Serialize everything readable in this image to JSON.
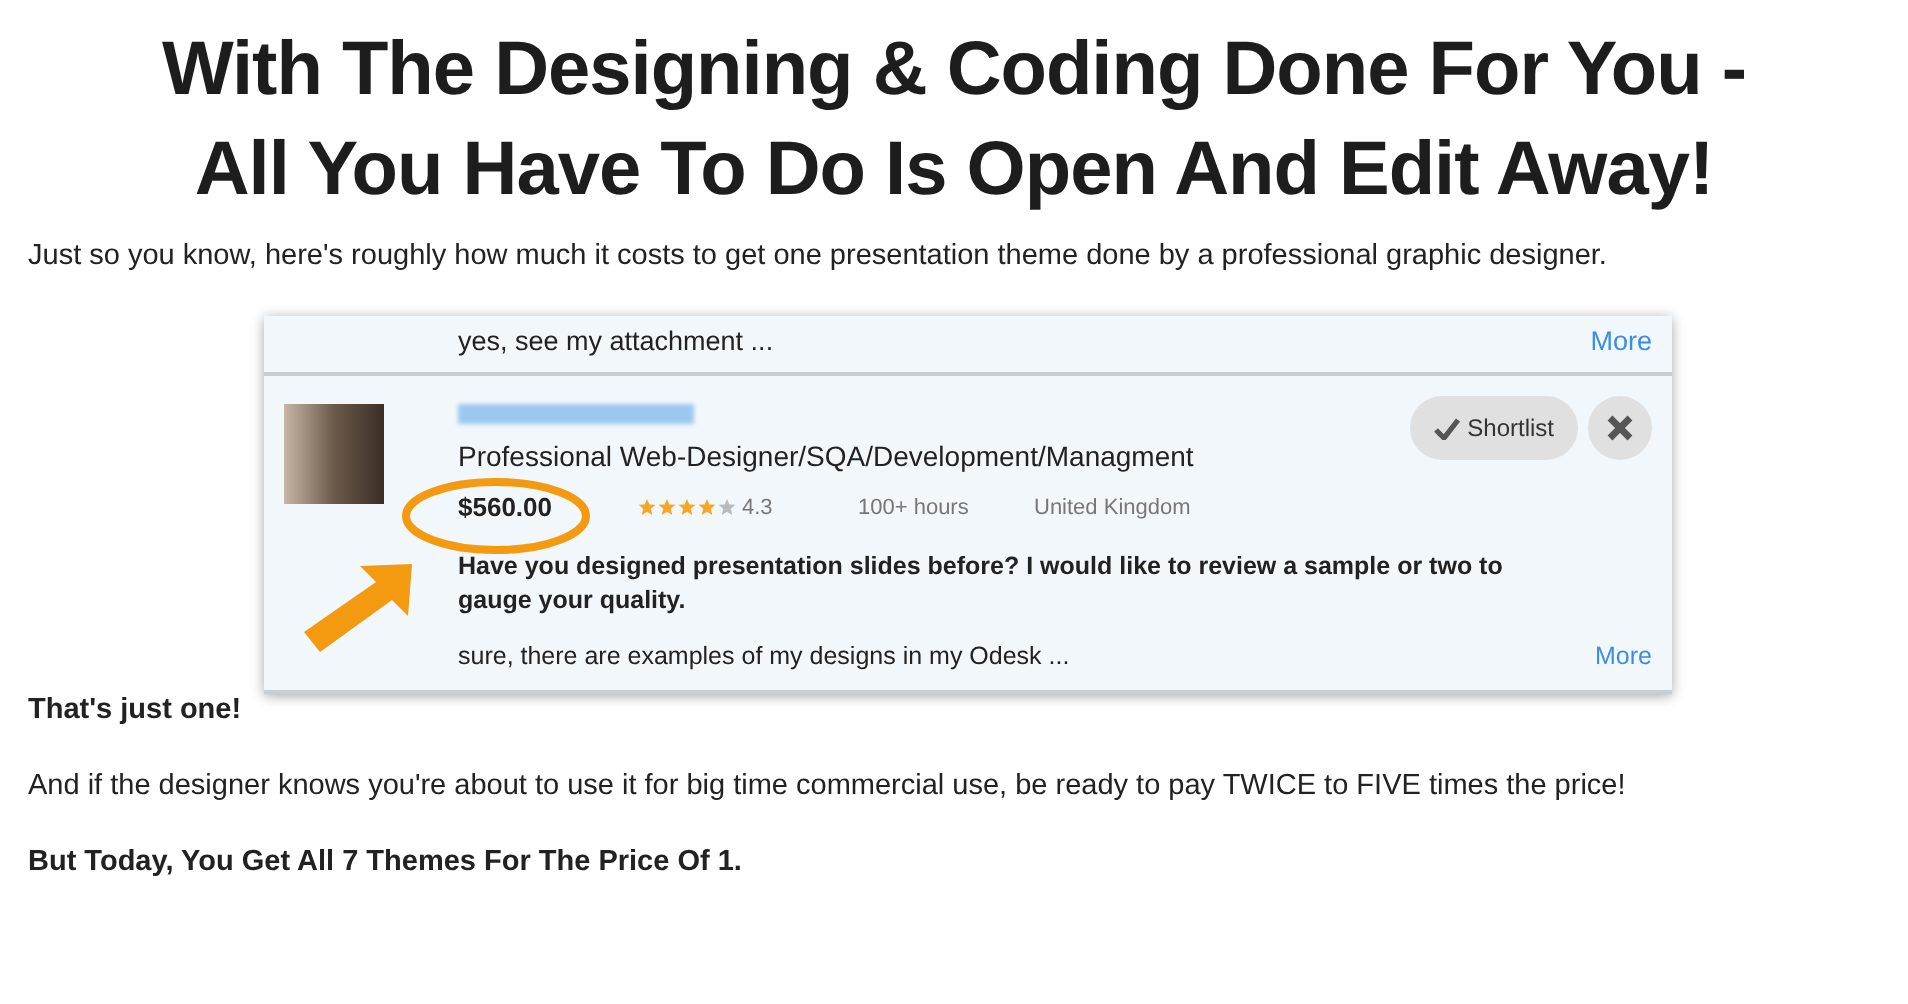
{
  "headline": [
    "With The Designing & Coding Done For You -",
    "All You Have To Do Is Open And Edit Away!"
  ],
  "intro": "Just so you know, here's roughly how much it costs to get one presentation theme done by a professional graphic designer.",
  "screenshot": {
    "previous_reply": {
      "text": "yes, see my attachment ...",
      "link": "More"
    },
    "applicant": {
      "title": "Professional Web-Designer/SQA/Development/Managment",
      "price": "$560.00",
      "stars": 4,
      "rating": "4.3",
      "hours": "100+ hours",
      "location": "United Kingdom",
      "shortlist": "Shortlist",
      "question": "Have you designed presentation slides before? I would like to review a sample or two to gauge your quality.",
      "answer": "sure, there are examples of my designs in my Odesk ...",
      "link": "More"
    }
  },
  "paragraphs": [
    {
      "text": "That's just one!",
      "bold": true
    },
    {
      "text": "And if the designer knows you're about to use it for big time commercial use, be ready to pay TWICE to FIVE times the price!",
      "bold": false
    },
    {
      "text": "But Today, You Get All 7 Themes For The Price Of 1.",
      "bold": true
    }
  ]
}
